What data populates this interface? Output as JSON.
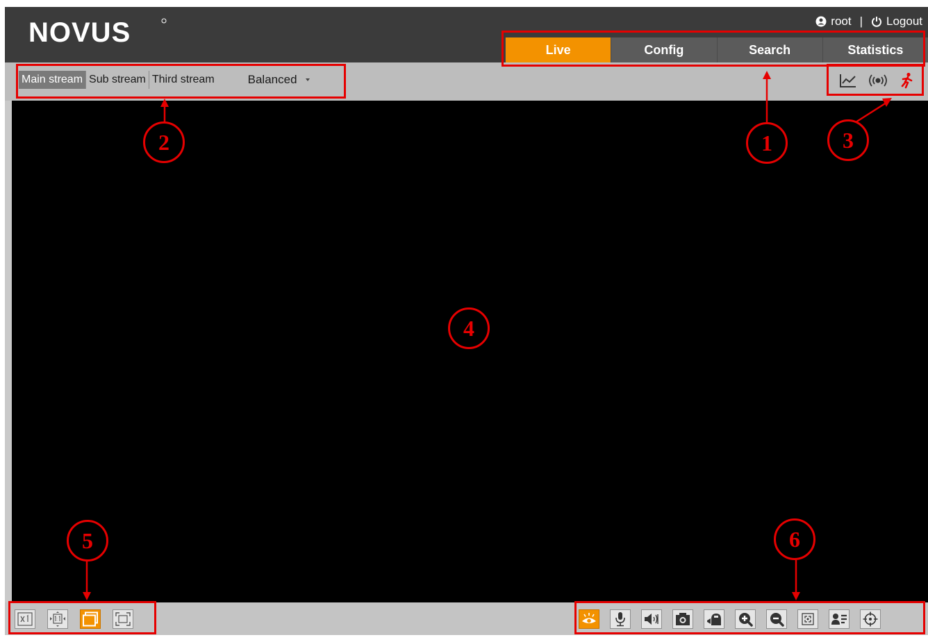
{
  "brand": {
    "logo_text": "NOVUS"
  },
  "user": {
    "name": "root",
    "separator": "|",
    "logout_label": "Logout"
  },
  "tabs": [
    {
      "label": "Live",
      "active": true
    },
    {
      "label": "Config",
      "active": false
    },
    {
      "label": "Search",
      "active": false
    },
    {
      "label": "Statistics",
      "active": false
    }
  ],
  "streams": {
    "items": [
      {
        "label": "Main stream",
        "active": true
      },
      {
        "label": "Sub stream",
        "active": false
      },
      {
        "label": "Third stream",
        "active": false
      }
    ],
    "quality": "Balanced"
  },
  "status_icons": [
    "chart-icon",
    "alarm-signal-icon",
    "motion-detection-icon"
  ],
  "view_tools": [
    "original-size-icon",
    "fit-window-icon",
    "stretch-icon",
    "fullscreen-icon"
  ],
  "live_tools": [
    "live-view-icon",
    "microphone-icon",
    "speaker-icon",
    "snapshot-icon",
    "record-icon",
    "zoom-in-icon",
    "zoom-out-icon",
    "focus-icon",
    "face-detection-icon",
    "ptz-target-icon"
  ],
  "annotations": {
    "1": "1",
    "2": "2",
    "3": "3",
    "4": "4",
    "5": "5",
    "6": "6"
  },
  "colors": {
    "accent": "#f39200",
    "header": "#3b3b3b",
    "annotation": "#e60000",
    "video_bg": "#000000"
  }
}
